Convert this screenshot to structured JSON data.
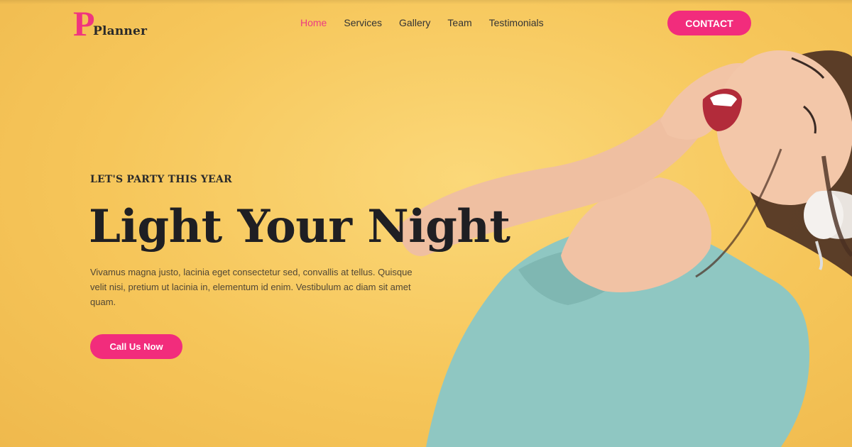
{
  "header": {
    "logo_letter": "P",
    "logo_text": "Planner",
    "nav": [
      {
        "label": "Home",
        "active": true
      },
      {
        "label": "Services",
        "active": false
      },
      {
        "label": "Gallery",
        "active": false
      },
      {
        "label": "Team",
        "active": false
      },
      {
        "label": "Testimonials",
        "active": false
      }
    ],
    "contact_label": "CONTACT"
  },
  "hero": {
    "eyebrow": "LET'S PARTY THIS YEAR",
    "title": "Light Your Night",
    "text": "Vivamus magna justo, lacinia eget consectetur sed, convallis at tellus. Quisque velit nisi, pretium ut lacinia in, elementum id enim. Vestibulum ac diam sit amet quam.",
    "cta_label": "Call Us Now"
  },
  "colors": {
    "accent": "#f22c7c",
    "background": "#f7c95a",
    "heading": "#1f1f23"
  },
  "icons": [
    "logo-mark",
    "hero-photo-woman-with-headphones"
  ]
}
